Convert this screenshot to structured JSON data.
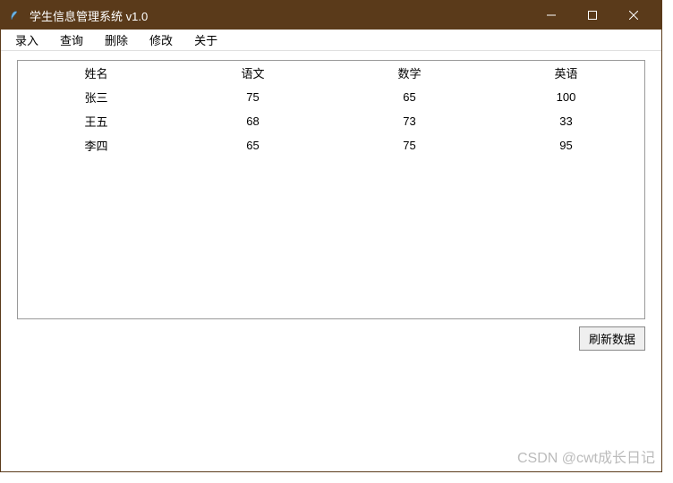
{
  "window": {
    "title": "学生信息管理系统 v1.0"
  },
  "menu": {
    "items": [
      "录入",
      "查询",
      "删除",
      "修改",
      "关于"
    ]
  },
  "table": {
    "headers": [
      "姓名",
      "语文",
      "数学",
      "英语"
    ],
    "rows": [
      [
        "张三",
        "75",
        "65",
        "100"
      ],
      [
        "王五",
        "68",
        "73",
        "33"
      ],
      [
        "李四",
        "65",
        "75",
        "95"
      ]
    ]
  },
  "buttons": {
    "refresh": "刷新数据"
  },
  "watermark": "CSDN @cwt成长日记"
}
